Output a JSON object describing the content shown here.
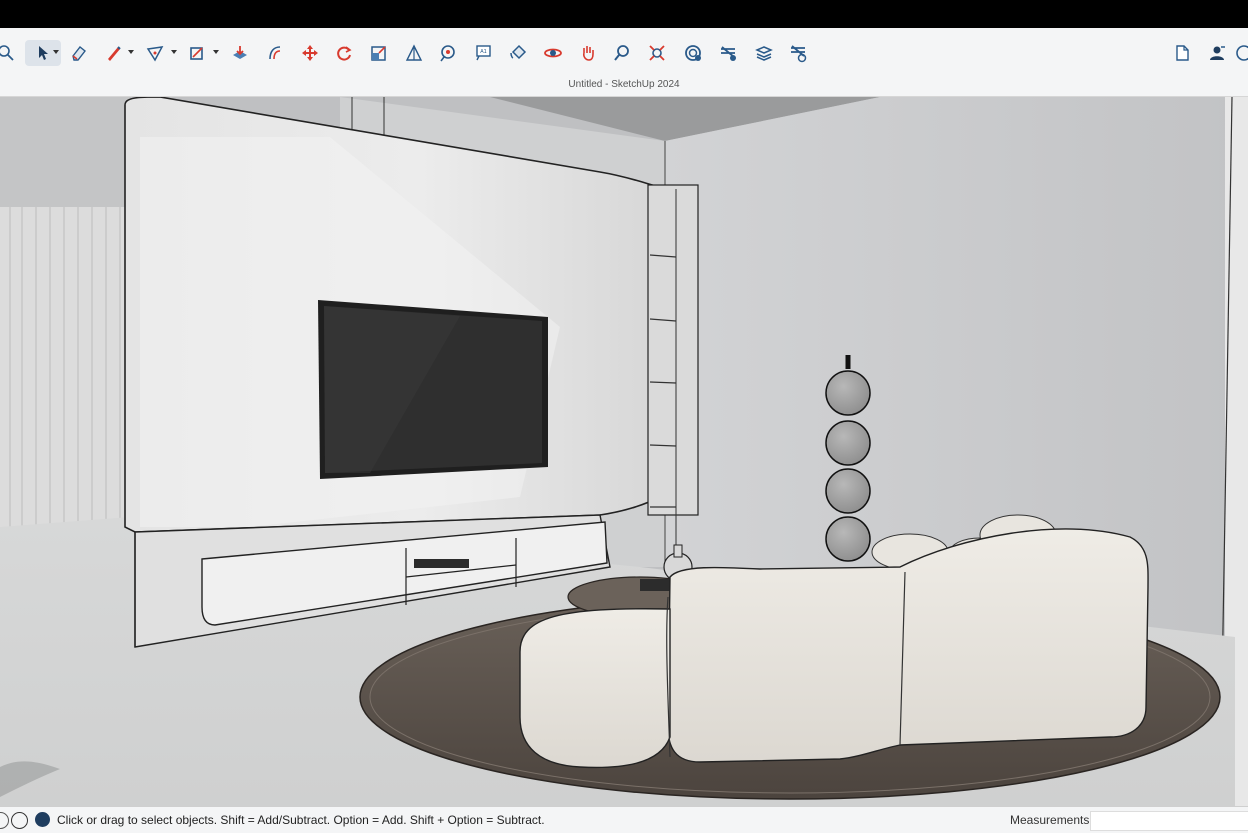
{
  "window": {
    "title": "Untitled - SketchUp 2024"
  },
  "toolbar": {
    "tools": [
      {
        "name": "search-icon",
        "label": "Search"
      },
      {
        "name": "select-arrow-icon",
        "label": "Select"
      },
      {
        "name": "eraser-icon",
        "label": "Eraser"
      },
      {
        "name": "pencil-line-icon",
        "label": "Line"
      },
      {
        "name": "freehand-arc-icon",
        "label": "Arc"
      },
      {
        "name": "rectangle-icon",
        "label": "Rectangle"
      },
      {
        "name": "push-pull-icon",
        "label": "Push/Pull"
      },
      {
        "name": "offset-icon",
        "label": "Offset"
      },
      {
        "name": "move-icon",
        "label": "Move"
      },
      {
        "name": "rotate-icon",
        "label": "Rotate"
      },
      {
        "name": "scale-icon",
        "label": "Scale"
      },
      {
        "name": "follow-me-icon",
        "label": "Follow Me"
      },
      {
        "name": "tape-measure-icon",
        "label": "Tape Measure"
      },
      {
        "name": "text-icon",
        "label": "Text"
      },
      {
        "name": "paint-bucket-icon",
        "label": "Paint Bucket"
      },
      {
        "name": "orbit-icon",
        "label": "Orbit"
      },
      {
        "name": "pan-icon",
        "label": "Pan"
      },
      {
        "name": "zoom-icon",
        "label": "Zoom"
      },
      {
        "name": "zoom-extents-icon",
        "label": "Zoom Extents"
      },
      {
        "name": "3d-warehouse-icon",
        "label": "3D Warehouse"
      },
      {
        "name": "extension-warehouse-icon",
        "label": "Extension Warehouse"
      },
      {
        "name": "layout-send-icon",
        "label": "Send to LayOut"
      },
      {
        "name": "extension-manager-icon",
        "label": "Extension Manager"
      }
    ],
    "right_tools": [
      {
        "name": "new-file-icon",
        "label": "New"
      },
      {
        "name": "account-icon",
        "label": "Account"
      },
      {
        "name": "help-icon",
        "label": "Help"
      }
    ]
  },
  "statusbar": {
    "hint": "Click or drag to select objects. Shift = Add/Subtract. Option = Add. Shift + Option = Subtract.",
    "measurements_label": "Measurements",
    "measurements_value": ""
  },
  "colors": {
    "toolbar_bg": "#f4f5f6",
    "icon_blue": "#2a5a8a",
    "icon_red": "#d83a2e",
    "sofa": "#e9e6e0",
    "rug": "#5c534c",
    "tv": "#2f2f2f"
  }
}
